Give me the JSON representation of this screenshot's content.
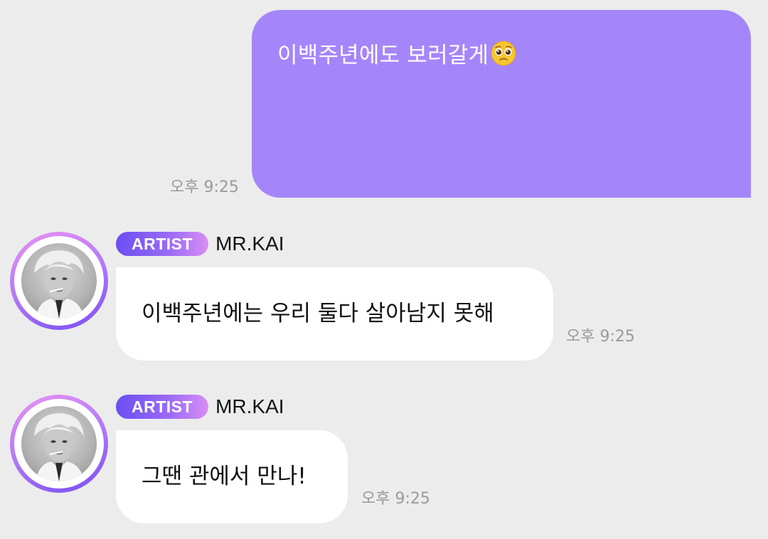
{
  "messages": [
    {
      "direction": "outgoing",
      "text": "이백주년에도 보러갈게",
      "emoji": "pleading-face-icon",
      "time": "오후 9:25"
    },
    {
      "direction": "incoming",
      "badge": "ARTIST",
      "sender": "MR.KAI",
      "text": "이백주년에는 우리 둘다 살아남지 못해",
      "time": "오후 9:25"
    },
    {
      "direction": "incoming",
      "badge": "ARTIST",
      "sender": "MR.KAI",
      "text": "그땐 관에서 만나!",
      "time": "오후 9:25"
    }
  ],
  "colors": {
    "background": "#ececec",
    "outgoing_bubble": "#a586fa",
    "incoming_bubble": "#ffffff",
    "timestamp": "#9a9a9a",
    "badge_gradient_start": "#6a4ef3",
    "badge_gradient_end": "#d98ef4"
  }
}
